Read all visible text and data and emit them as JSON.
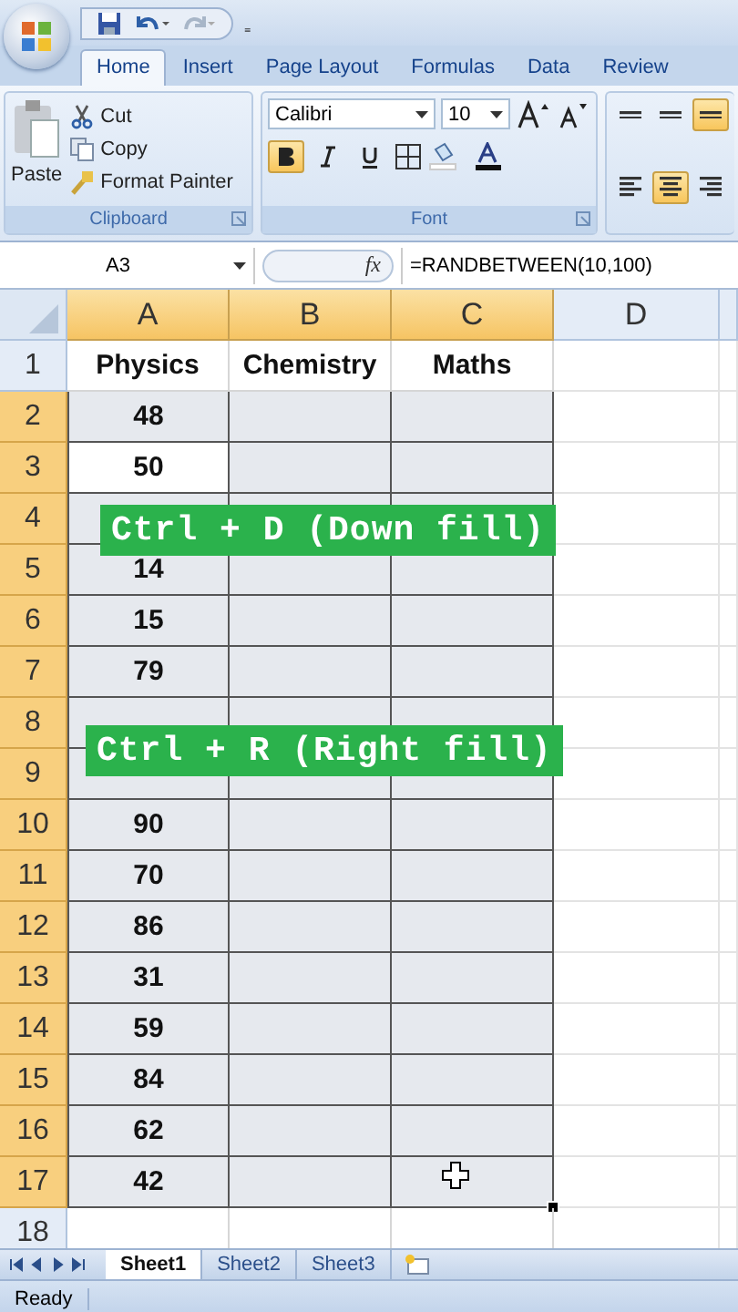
{
  "quick_access": {
    "more": "₌"
  },
  "tabs": [
    {
      "label": "Home",
      "selected": true
    },
    {
      "label": "Insert",
      "selected": false
    },
    {
      "label": "Page Layout",
      "selected": false
    },
    {
      "label": "Formulas",
      "selected": false
    },
    {
      "label": "Data",
      "selected": false
    },
    {
      "label": "Review",
      "selected": false
    }
  ],
  "clipboard": {
    "paste": "Paste",
    "cut": "Cut",
    "copy": "Copy",
    "format_painter": "Format Painter",
    "title": "Clipboard"
  },
  "font": {
    "name": "Calibri",
    "size": "10",
    "title": "Font",
    "bold": true,
    "italic": false,
    "underline": false
  },
  "alignment": [
    {
      "kind": "top",
      "selected": false
    },
    {
      "kind": "middle",
      "selected": false
    },
    {
      "kind": "bottom",
      "selected": true
    },
    {
      "kind": "left",
      "selected": false
    },
    {
      "kind": "center",
      "selected": true
    },
    {
      "kind": "right",
      "selected": false
    }
  ],
  "formula_bar": {
    "name_box": "A3",
    "function_label": "fx",
    "formula": "=RANDBETWEEN(10,100)"
  },
  "columns": [
    {
      "label": "A",
      "selected": true
    },
    {
      "label": "B",
      "selected": true
    },
    {
      "label": "C",
      "selected": true
    },
    {
      "label": "D",
      "selected": false
    }
  ],
  "rows": [
    {
      "number": "1",
      "selected": false,
      "active_cell": false,
      "cells": [
        "Physics",
        "Chemistry",
        "Maths"
      ]
    },
    {
      "number": "2",
      "selected": true,
      "active_cell": false,
      "cells": [
        "48"
      ]
    },
    {
      "number": "3",
      "selected": true,
      "active_cell": true,
      "cells": [
        "50"
      ]
    },
    {
      "number": "4",
      "selected": true,
      "active_cell": false
    },
    {
      "number": "5",
      "selected": true,
      "active_cell": false,
      "cells": [
        "14"
      ]
    },
    {
      "number": "6",
      "selected": true,
      "active_cell": false,
      "cells": [
        "15"
      ]
    },
    {
      "number": "7",
      "selected": true,
      "active_cell": false,
      "cells": [
        "79"
      ]
    },
    {
      "number": "8",
      "selected": true,
      "active_cell": false
    },
    {
      "number": "9",
      "selected": true,
      "active_cell": false
    },
    {
      "number": "10",
      "selected": true,
      "active_cell": false,
      "cells": [
        "90"
      ]
    },
    {
      "number": "11",
      "selected": true,
      "active_cell": false,
      "cells": [
        "70"
      ]
    },
    {
      "number": "12",
      "selected": true,
      "active_cell": false,
      "cells": [
        "86"
      ]
    },
    {
      "number": "13",
      "selected": true,
      "active_cell": false,
      "cells": [
        "31"
      ]
    },
    {
      "number": "14",
      "selected": true,
      "active_cell": false,
      "cells": [
        "59"
      ]
    },
    {
      "number": "15",
      "selected": true,
      "active_cell": false,
      "cells": [
        "84"
      ]
    },
    {
      "number": "16",
      "selected": true,
      "active_cell": false,
      "cells": [
        "62"
      ]
    },
    {
      "number": "17",
      "selected": true,
      "active_cell": false,
      "cells": [
        "42"
      ]
    },
    {
      "number": "18",
      "selected": false,
      "active_cell": false
    }
  ],
  "captions": [
    "Ctrl + D (Down fill)",
    "Ctrl + R (Right fill)"
  ],
  "sheet_tabs": [
    {
      "label": "Sheet1",
      "selected": true
    },
    {
      "label": "Sheet2",
      "selected": false
    },
    {
      "label": "Sheet3",
      "selected": false
    }
  ],
  "status": "Ready"
}
